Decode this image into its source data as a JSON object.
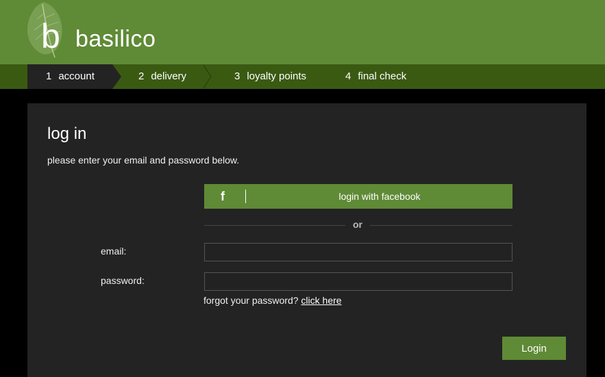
{
  "brand": {
    "name": "basilico",
    "logo_letter": "b",
    "leaf_icon": "leaf-icon"
  },
  "colors": {
    "header": "#5f8a36",
    "steps_bar": "#3a5a12",
    "panel": "#232323",
    "accent": "#5f8a36"
  },
  "steps": [
    {
      "num": "1",
      "label": "account",
      "active": true
    },
    {
      "num": "2",
      "label": "delivery",
      "active": false
    },
    {
      "num": "3",
      "label": "loyalty points",
      "active": false
    },
    {
      "num": "4",
      "label": "final check",
      "active": false
    }
  ],
  "login": {
    "title": "log in",
    "subtitle": "please enter your email and password below.",
    "facebook": {
      "icon": "f",
      "label": "login with facebook"
    },
    "divider": "or",
    "email_label": "email:",
    "email_value": "",
    "password_label": "password:",
    "password_value": "",
    "forgot_text": "forgot your password?",
    "forgot_link": "click here",
    "submit": "Login"
  }
}
